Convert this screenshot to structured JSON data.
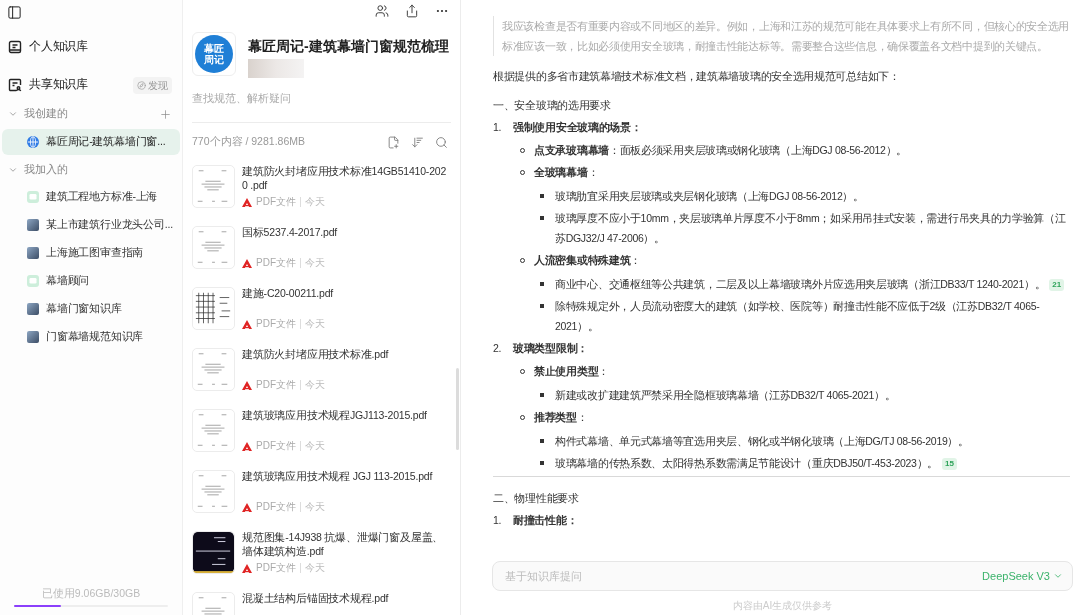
{
  "sidebar": {
    "nav": [
      {
        "kind": "personal",
        "label": "个人知识库"
      },
      {
        "kind": "shared",
        "label": "共享知识库",
        "action": "发现"
      }
    ],
    "groups": [
      {
        "label": "我创建的",
        "expanded": true,
        "addable": true,
        "items": [
          {
            "label": "幕匠周记-建筑幕墙门窗...",
            "kind": "globe",
            "selected": true
          }
        ]
      },
      {
        "label": "我加入的",
        "expanded": true,
        "addable": false,
        "items": [
          {
            "label": "建筑工程地方标准-上海",
            "kind": "chat",
            "selected": false
          },
          {
            "label": "某上市建筑行业龙头公司...",
            "kind": "image",
            "selected": false
          },
          {
            "label": "上海施工图审查指南",
            "kind": "image",
            "selected": false
          },
          {
            "label": "幕墙顾问",
            "kind": "chat",
            "selected": false
          },
          {
            "label": "幕墙门窗知识库",
            "kind": "image",
            "selected": false
          },
          {
            "label": "门窗幕墙规范知识库",
            "kind": "image",
            "selected": false
          }
        ]
      }
    ],
    "storage": {
      "label": "已使用9.06GB/30GB",
      "level": 0.302
    }
  },
  "knowledge_base": {
    "logo_lines": [
      "幕匠",
      "周记"
    ],
    "title": "幕匠周记-建筑幕墙门窗规范梳理",
    "description": "查找规范、解析疑问",
    "summary": "770个内容 / 9281.86MB",
    "files": [
      {
        "name": "建筑防火封堵应用技术标准14GB51410-2020 .pdf",
        "type": "PDF文件",
        "date": "今天",
        "kind": "document"
      },
      {
        "name": "国标5237.4-2017.pdf",
        "type": "PDF文件",
        "date": "今天",
        "kind": "document"
      },
      {
        "name": "建施-C20-00211.pdf",
        "type": "PDF文件",
        "date": "今天",
        "kind": "drawing"
      },
      {
        "name": "建筑防火封堵应用技术标准.pdf",
        "type": "PDF文件",
        "date": "今天",
        "kind": "document"
      },
      {
        "name": "建筑玻璃应用技术规程JGJ113-2015.pdf",
        "type": "PDF文件",
        "date": "今天",
        "kind": "document"
      },
      {
        "name": "建筑玻璃应用技术规程 JGJ 113-2015.pdf",
        "type": "PDF文件",
        "date": "今天",
        "kind": "document"
      },
      {
        "name": "规范图集-14J938 抗爆、泄爆门窗及屋盖、墙体建筑构造.pdf",
        "type": "PDF文件",
        "date": "今天",
        "kind": "dark"
      },
      {
        "name": "混凝土结构后锚固技术规程.pdf",
        "kind": "document"
      }
    ]
  },
  "answer": {
    "reasoning": "我应该检查是否有重要内容或不同地区的差异。例如，上海和江苏的规范可能在具体要求上有所不同，但核心的安全选用标准应该一致，比如必须使用安全玻璃，耐撞击性能达标等。需要整合这些信息，确保覆盖各文档中提到的关键点。",
    "intro": "根据提供的多省市建筑幕墙技术标准文档，建筑幕墙玻璃的安全选用规范可总结如下：",
    "sections": [
      {
        "heading": "一、安全玻璃的选用要求",
        "items": [
          {
            "number": "1.",
            "text": "强制使用安全玻璃的场景：",
            "children": [
              {
                "text": "**点支承玻璃幕墙**：面板必须采用夹层玻璃或钢化玻璃（上海DGJ 08-56-2012）。"
              },
              {
                "text": "**全玻璃幕墙**：",
                "children": [
                  {
                    "text": "玻璃肋宜采用夹层玻璃或夹层钢化玻璃（上海DGJ 08-56-2012）。"
                  },
                  {
                    "text": "玻璃厚度不应小于10mm，夹层玻璃单片厚度不小于8mm；如采用吊挂式安装，需进行吊夹具的力学验算（江苏DGJ32/J 47-2006）。"
                  }
                ]
              },
              {
                "text": "**人流密集或特殊建筑**：",
                "children": [
                  {
                    "text": "商业中心、交通枢纽等公共建筑，二层及以上幕墙玻璃外片应选用夹层玻璃（浙江DB33/T 1240-2021）。",
                    "citation": "21"
                  },
                  {
                    "text": "除特殊规定外，人员流动密度大的建筑（如学校、医院等）耐撞击性能不应低于2级（江苏DB32/T 4065-2021）。"
                  }
                ]
              }
            ]
          },
          {
            "number": "2.",
            "text": "玻璃类型限制：",
            "children": [
              {
                "text": "**禁止使用类型**：",
                "children": [
                  {
                    "text": "新建或改扩建建筑严禁采用全隐框玻璃幕墙（江苏DB32/T 4065-2021）。"
                  }
                ]
              },
              {
                "text": "**推荐类型**：",
                "children": [
                  {
                    "text": "构件式幕墙、单元式幕墙等宜选用夹层、钢化或半钢化玻璃（上海DG/TJ 08-56-2019）。"
                  },
                  {
                    "text": "玻璃幕墙的传热系数、太阳得热系数需满足节能设计（重庆DBJ50/T-453-2023）。",
                    "citation": "15"
                  }
                ]
              }
            ]
          }
        ]
      },
      {
        "heading": "二、物理性能要求",
        "items": [
          {
            "number": "1.",
            "text": "耐撞击性能："
          }
        ]
      }
    ]
  },
  "composer": {
    "placeholder": "基于知识库提问",
    "model": "DeepSeek V3",
    "disclaimer": "内容由AI生成仅供参考"
  }
}
